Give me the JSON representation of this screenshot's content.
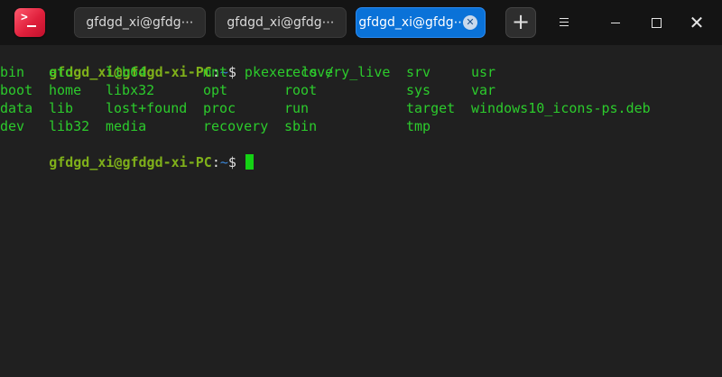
{
  "window": {
    "tabs": [
      {
        "label": "gfdgd_xi@gfdg⋯",
        "active": false
      },
      {
        "label": "gfdgd_xi@gfdg⋯",
        "active": false
      },
      {
        "label": "gfdgd_xi@gfdg⋯",
        "active": true
      }
    ],
    "new_tab_label": "+",
    "close_label": "✕",
    "tab_close_label": "✕"
  },
  "icons": [
    "terminal-app-icon",
    "plus-icon",
    "menu-icon",
    "minimize-icon",
    "maximize-icon",
    "close-icon"
  ],
  "terminal": {
    "prompt_user": "gfdgd_xi@gfdgd-xi-PC",
    "prompt_colon": ":",
    "prompt_path": "~",
    "prompt_dollar": "$",
    "command": " pkexec ls /",
    "ls_rows": [
      [
        "bin",
        "etc",
        "lib64",
        "mnt",
        "recovery_live",
        "srv",
        "usr"
      ],
      [
        "boot",
        "home",
        "libx32",
        "opt",
        "root",
        "sys",
        "var"
      ],
      [
        "data",
        "lib",
        "lost+found",
        "proc",
        "run",
        "target",
        "windows10_icons-ps.deb"
      ],
      [
        "dev",
        "lib32",
        "media",
        "recovery",
        "sbin",
        "tmp"
      ]
    ]
  },
  "colors": {
    "prompt_user": "#7fb01a",
    "prompt_path": "#3a86d8",
    "output": "#2ccb2c",
    "active_tab": "#0a72d8",
    "background": "#202020"
  }
}
